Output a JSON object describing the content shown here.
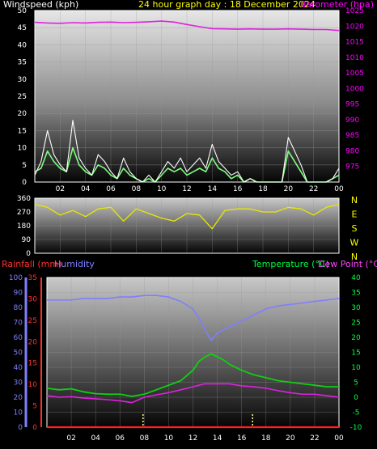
{
  "header": {
    "wind_label": "Windspeed (kph)",
    "title": "24 hour graph day : 18 December 2024",
    "baro_label": "Barometer (hpa)"
  },
  "lower_header": {
    "rain_label": "Rainfall (mm)",
    "humidity_label": "Humidity",
    "temp_label": "Temperature (°C)",
    "dew_label": "Dew Point (°C)"
  },
  "colors": {
    "wind": "#ffffff",
    "gust": "#7cff7c",
    "baro": "#e020e0",
    "direction": "#e8e800",
    "rain": "#ff2020",
    "humidity": "#7f7fff",
    "temperature": "#10d010",
    "dewpoint": "#e020e0",
    "label_wind": "#ffffff",
    "label_yellow": "#ffff00",
    "label_baro": "#ff00ff",
    "label_rain": "#ff3030",
    "label_hum": "#8080ff",
    "label_temp": "#00ff40",
    "label_dew": "#ff40ff",
    "sunrise_marker": "#ffff80"
  },
  "chart_data": [
    {
      "type": "line",
      "title": "24 hour graph day : 18 December 2024",
      "x_ticks": [
        "02",
        "04",
        "06",
        "08",
        "10",
        "12",
        "14",
        "16",
        "18",
        "20",
        "22",
        "00"
      ],
      "left_axis": {
        "label": "Windspeed (kph)",
        "ylim": [
          0,
          50
        ],
        "ticks": [
          "0",
          "5",
          "10",
          "15",
          "20",
          "25",
          "30",
          "35",
          "40",
          "45",
          "50"
        ]
      },
      "right_axis": {
        "label": "Barometer (hpa)",
        "ylim": [
          970,
          1025
        ],
        "ticks": [
          "975",
          "980",
          "985",
          "990",
          "995",
          "1000",
          "1005",
          "1010",
          "1015",
          "1020",
          "1025"
        ]
      },
      "series": [
        {
          "name": "Windspeed (kph)",
          "axis": "left",
          "x": [
            0,
            0.5,
            1,
            1.5,
            2,
            2.5,
            3,
            3.5,
            4,
            4.5,
            5,
            5.5,
            6,
            6.5,
            7,
            7.5,
            8,
            8.5,
            9,
            9.5,
            10,
            10.5,
            11,
            11.5,
            12,
            12.5,
            13,
            13.5,
            14,
            14.5,
            15,
            15.5,
            16,
            16.5,
            17,
            17.5,
            18,
            18.5,
            19,
            19.5,
            20,
            20.5,
            21,
            21.5,
            22,
            22.5,
            23,
            23.5,
            24
          ],
          "values": [
            2,
            6,
            15,
            8,
            5,
            3,
            18,
            7,
            4,
            2,
            8,
            6,
            3,
            1,
            7,
            3,
            1,
            0,
            2,
            0,
            3,
            6,
            4,
            7,
            3,
            5,
            7,
            4,
            11,
            6,
            4,
            2,
            3,
            0,
            1,
            0,
            0,
            0,
            0,
            0,
            13,
            9,
            5,
            0,
            0,
            0,
            0,
            1,
            4
          ]
        },
        {
          "name": "Wind gust (kph)",
          "axis": "left",
          "x": [
            0,
            0.5,
            1,
            1.5,
            2,
            2.5,
            3,
            3.5,
            4,
            4.5,
            5,
            5.5,
            6,
            6.5,
            7,
            7.5,
            8,
            8.5,
            9,
            9.5,
            10,
            10.5,
            11,
            11.5,
            12,
            12.5,
            13,
            13.5,
            14,
            14.5,
            15,
            15.5,
            16,
            16.5,
            17,
            17.5,
            18,
            18.5,
            19,
            19.5,
            20,
            20.5,
            21,
            21.5,
            22,
            22.5,
            23,
            23.5,
            24
          ],
          "values": [
            3,
            4,
            9,
            6,
            4,
            3,
            10,
            5,
            3,
            2,
            5,
            4,
            2,
            1,
            4,
            2,
            1,
            0,
            1,
            0,
            2,
            4,
            3,
            4,
            2,
            3,
            4,
            3,
            7,
            4,
            3,
            1,
            2,
            0,
            1,
            0,
            0,
            0,
            0,
            0,
            9,
            6,
            3,
            0,
            0,
            0,
            0,
            1,
            2
          ]
        },
        {
          "name": "Barometer (hpa)",
          "axis": "right",
          "x": [
            0,
            1,
            2,
            3,
            4,
            5,
            6,
            7,
            8,
            9,
            10,
            11,
            12,
            13,
            14,
            15,
            16,
            17,
            18,
            19,
            20,
            21,
            22,
            23,
            24
          ],
          "values": [
            1021.2,
            1021.0,
            1020.9,
            1021.1,
            1021.0,
            1021.2,
            1021.3,
            1021.1,
            1021.2,
            1021.4,
            1021.6,
            1021.3,
            1020.5,
            1019.8,
            1019.2,
            1019.1,
            1019.0,
            1019.1,
            1019.0,
            1019.0,
            1019.1,
            1019.0,
            1018.9,
            1018.9,
            1018.6
          ]
        }
      ]
    },
    {
      "type": "line",
      "title": "",
      "left_ticks": [
        "0",
        "90",
        "180",
        "270",
        "360"
      ],
      "right_ticks": [
        "N",
        "W",
        "S",
        "E",
        "N"
      ],
      "ylim": [
        0,
        360
      ],
      "series": [
        {
          "name": "Wind direction (°)",
          "x": [
            0,
            1,
            2,
            3,
            4,
            5,
            6,
            7,
            8,
            9,
            10,
            11,
            12,
            13,
            14,
            15,
            16,
            17,
            18,
            19,
            20,
            21,
            22,
            23,
            24
          ],
          "values": [
            320,
            300,
            250,
            280,
            240,
            290,
            300,
            210,
            290,
            260,
            230,
            210,
            260,
            250,
            160,
            280,
            290,
            290,
            270,
            270,
            300,
            290,
            250,
            300,
            320
          ]
        }
      ]
    },
    {
      "type": "line",
      "title": "",
      "x_ticks": [
        "02",
        "04",
        "06",
        "08",
        "10",
        "12",
        "14",
        "16",
        "18",
        "20",
        "22",
        "00"
      ],
      "humidity_axis": {
        "label": "Humidity",
        "ylim": [
          0,
          100
        ],
        "ticks": [
          "0",
          "10",
          "20",
          "30",
          "40",
          "50",
          "60",
          "70",
          "80",
          "90",
          "100"
        ]
      },
      "rain_axis": {
        "label": "Rainfall (mm)",
        "ylim": [
          0,
          35
        ],
        "ticks": [
          "0",
          "5",
          "10",
          "15",
          "20",
          "25",
          "30",
          "35"
        ]
      },
      "temp_axis": {
        "label": "Temperature (°C)",
        "ylim": [
          -10,
          40
        ],
        "ticks": [
          "-10",
          "-5",
          "0",
          "5",
          "10",
          "15",
          "20",
          "25",
          "30",
          "35",
          "40"
        ]
      },
      "series": [
        {
          "name": "Humidity",
          "axis": "humidity",
          "x": [
            0,
            1,
            2,
            3,
            4,
            5,
            6,
            7,
            8,
            9,
            10,
            11,
            12,
            12.5,
            13,
            13.5,
            14,
            14.5,
            15,
            16,
            17,
            18,
            19,
            20,
            21,
            22,
            23,
            24
          ],
          "values": [
            85,
            85,
            85,
            86,
            86,
            86,
            87,
            87,
            88,
            88,
            87,
            84,
            79,
            73,
            65,
            58,
            63,
            65,
            67,
            71,
            75,
            79,
            81,
            82,
            83,
            84,
            85,
            86
          ]
        },
        {
          "name": "Temperature (°C)",
          "axis": "temp",
          "x": [
            0,
            1,
            2,
            3,
            4,
            5,
            6,
            7,
            8,
            9,
            10,
            11,
            12,
            12.5,
            13,
            13.5,
            14,
            14.5,
            15,
            16,
            17,
            18,
            19,
            20,
            21,
            22,
            23,
            24
          ],
          "values": [
            3.0,
            2.5,
            2.8,
            1.8,
            1.2,
            1.0,
            1.0,
            0.3,
            1.0,
            2.5,
            4.0,
            5.5,
            9.0,
            12.0,
            13.5,
            14.5,
            13.5,
            12.5,
            11.0,
            9.0,
            7.5,
            6.5,
            5.5,
            5.0,
            4.5,
            4.0,
            3.5,
            3.5
          ]
        },
        {
          "name": "Dew Point (°C)",
          "axis": "temp",
          "x": [
            0,
            1,
            2,
            3,
            4,
            5,
            6,
            7,
            8,
            9,
            10,
            11,
            12,
            12.5,
            13,
            13.5,
            14,
            14.5,
            15,
            16,
            17,
            18,
            19,
            20,
            21,
            22,
            23,
            24
          ],
          "values": [
            0.5,
            0.0,
            0.2,
            -0.3,
            -0.5,
            -0.8,
            -1.2,
            -1.8,
            0.0,
            0.8,
            1.5,
            2.5,
            3.5,
            4.0,
            4.5,
            4.5,
            4.5,
            4.5,
            4.5,
            3.8,
            3.5,
            3.0,
            2.2,
            1.5,
            1.0,
            1.0,
            0.5,
            0.0
          ]
        },
        {
          "name": "Rainfall (mm)",
          "axis": "rain",
          "x": [
            0,
            24
          ],
          "values": [
            0,
            0
          ]
        }
      ]
    }
  ]
}
